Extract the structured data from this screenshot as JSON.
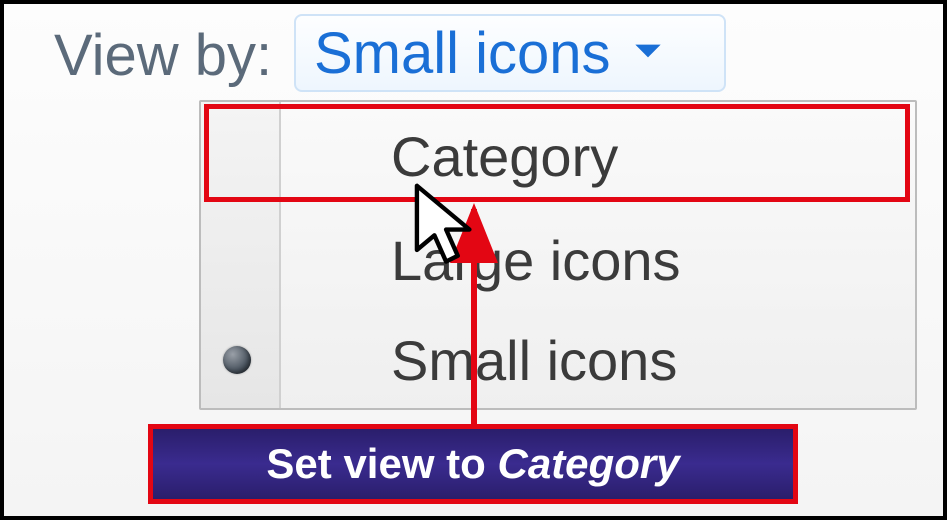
{
  "viewby": {
    "label": "View by:",
    "selected": "Small icons"
  },
  "menu": {
    "items": [
      {
        "label": "Category",
        "selected": false,
        "hovered": true
      },
      {
        "label": "Large icons",
        "selected": false,
        "hovered": false
      },
      {
        "label": "Small icons",
        "selected": true,
        "hovered": false
      }
    ]
  },
  "caption": {
    "prefix": "Set view to ",
    "emphasis": "Category"
  },
  "annotation": {
    "highlight_color": "#e30613"
  }
}
